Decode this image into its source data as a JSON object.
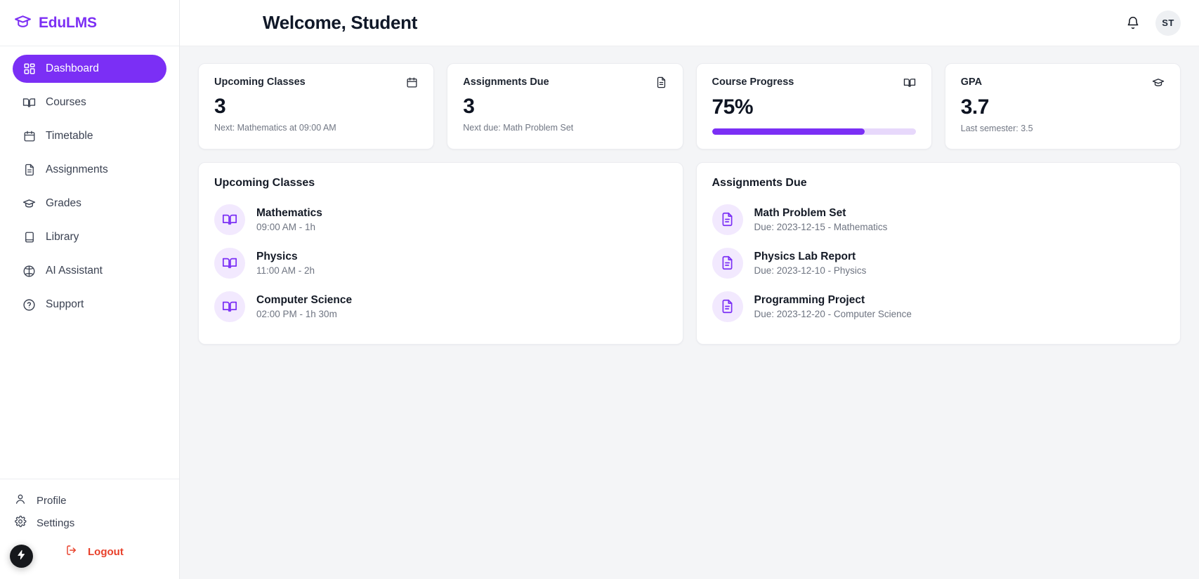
{
  "brand": {
    "name": "EduLMS",
    "logo_icon": "graduation-cap-icon",
    "accent_color": "#7b2ff5"
  },
  "sidebar": {
    "items": [
      {
        "label": "Dashboard",
        "icon": "grid-dashboard-icon",
        "active": true
      },
      {
        "label": "Courses",
        "icon": "book-open-icon",
        "active": false
      },
      {
        "label": "Timetable",
        "icon": "calendar-icon",
        "active": false
      },
      {
        "label": "Assignments",
        "icon": "file-text-icon",
        "active": false
      },
      {
        "label": "Grades",
        "icon": "graduation-cap-icon",
        "active": false
      },
      {
        "label": "Library",
        "icon": "book-icon",
        "active": false
      },
      {
        "label": "AI Assistant",
        "icon": "brain-icon",
        "active": false
      },
      {
        "label": "Support",
        "icon": "help-circle-icon",
        "active": false
      }
    ],
    "footer": [
      {
        "label": "Profile",
        "icon": "user-icon"
      },
      {
        "label": "Settings",
        "icon": "gear-icon"
      }
    ],
    "logout": {
      "label": "Logout",
      "icon": "logout-icon",
      "color": "#e8402a"
    },
    "fab": {
      "icon": "lightning-bolt-icon"
    }
  },
  "header": {
    "title": "Welcome, Student",
    "notifications_icon": "bell-icon",
    "avatar_initials": "ST"
  },
  "stats": [
    {
      "title": "Upcoming Classes",
      "icon": "calendar-icon",
      "value": "3",
      "subtitle": "Next: Mathematics at 09:00 AM",
      "has_progress": false
    },
    {
      "title": "Assignments Due",
      "icon": "file-text-icon",
      "value": "3",
      "subtitle": "Next due: Math Problem Set",
      "has_progress": false
    },
    {
      "title": "Course Progress",
      "icon": "book-open-icon",
      "value": "75%",
      "subtitle": "",
      "has_progress": true,
      "progress_percent": 75
    },
    {
      "title": "GPA",
      "icon": "graduation-cap-icon",
      "value": "3.7",
      "subtitle": "Last semester: 3.5",
      "has_progress": false
    }
  ],
  "panels": {
    "upcoming_classes": {
      "title": "Upcoming Classes",
      "items": [
        {
          "name": "Mathematics",
          "meta": "09:00 AM - 1h",
          "icon": "book-open-icon"
        },
        {
          "name": "Physics",
          "meta": "11:00 AM - 2h",
          "icon": "book-open-icon"
        },
        {
          "name": "Computer Science",
          "meta": "02:00 PM - 1h 30m",
          "icon": "book-open-icon"
        }
      ]
    },
    "assignments_due": {
      "title": "Assignments Due",
      "items": [
        {
          "name": "Math Problem Set",
          "meta": "Due: 2023-12-15 - Mathematics",
          "icon": "file-text-icon"
        },
        {
          "name": "Physics Lab Report",
          "meta": "Due: 2023-12-10 - Physics",
          "icon": "file-text-icon"
        },
        {
          "name": "Programming Project",
          "meta": "Due: 2023-12-20 - Computer Science",
          "icon": "file-text-icon"
        }
      ]
    }
  }
}
